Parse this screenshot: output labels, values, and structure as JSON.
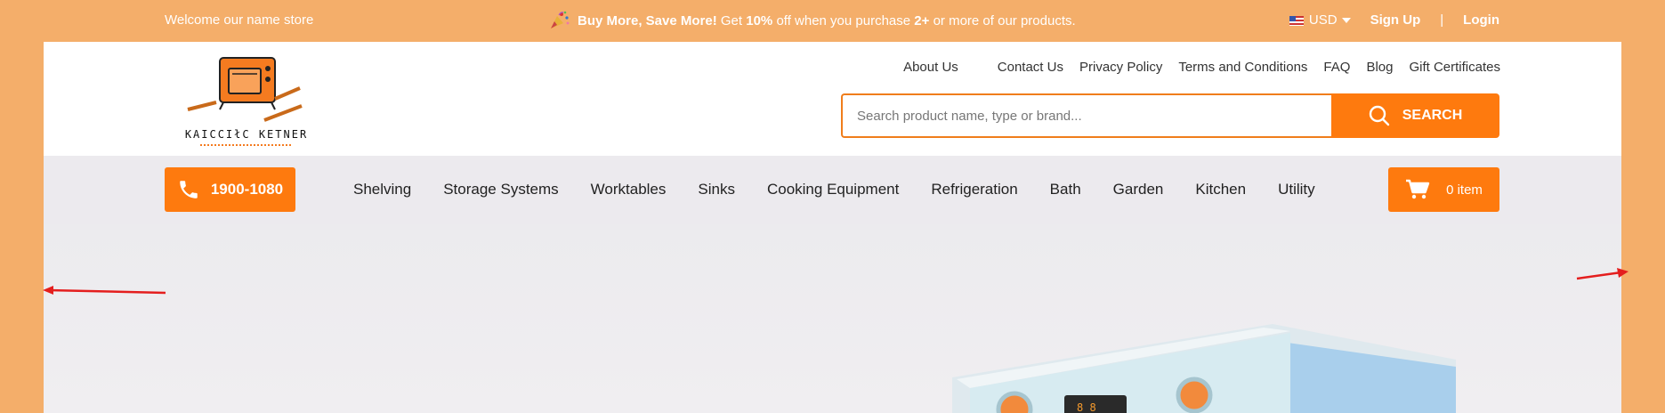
{
  "topbar": {
    "welcome": "Welcome our name store",
    "promo_bold": "Buy More, Save More!",
    "promo_get": "Get",
    "promo_percent": "10%",
    "promo_mid": "off when you purchase",
    "promo_qty": "2+",
    "promo_end": "or more of our products.",
    "currency": "USD",
    "sign_up": "Sign Up",
    "separator": "|",
    "login": "Login"
  },
  "header": {
    "logo_text": "KAICCIłC KETNER",
    "links": [
      "About Us",
      "Contact Us",
      "Privacy Policy",
      "Terms and Conditions",
      "FAQ",
      "Blog",
      "Gift Certificates"
    ],
    "search_placeholder": "Search product name, type or brand...",
    "search_button": "SEARCH"
  },
  "navbar": {
    "phone": "1900-1080",
    "items": [
      "Shelving",
      "Storage Systems",
      "Worktables",
      "Sinks",
      "Cooking Equipment",
      "Refrigeration",
      "Bath",
      "Garden",
      "Kitchen",
      "Utility"
    ],
    "cart": "0 item"
  },
  "colors": {
    "accent": "#fe7a0e",
    "page_bg": "#f4ae6a",
    "nav_bg": "#eceaee"
  }
}
